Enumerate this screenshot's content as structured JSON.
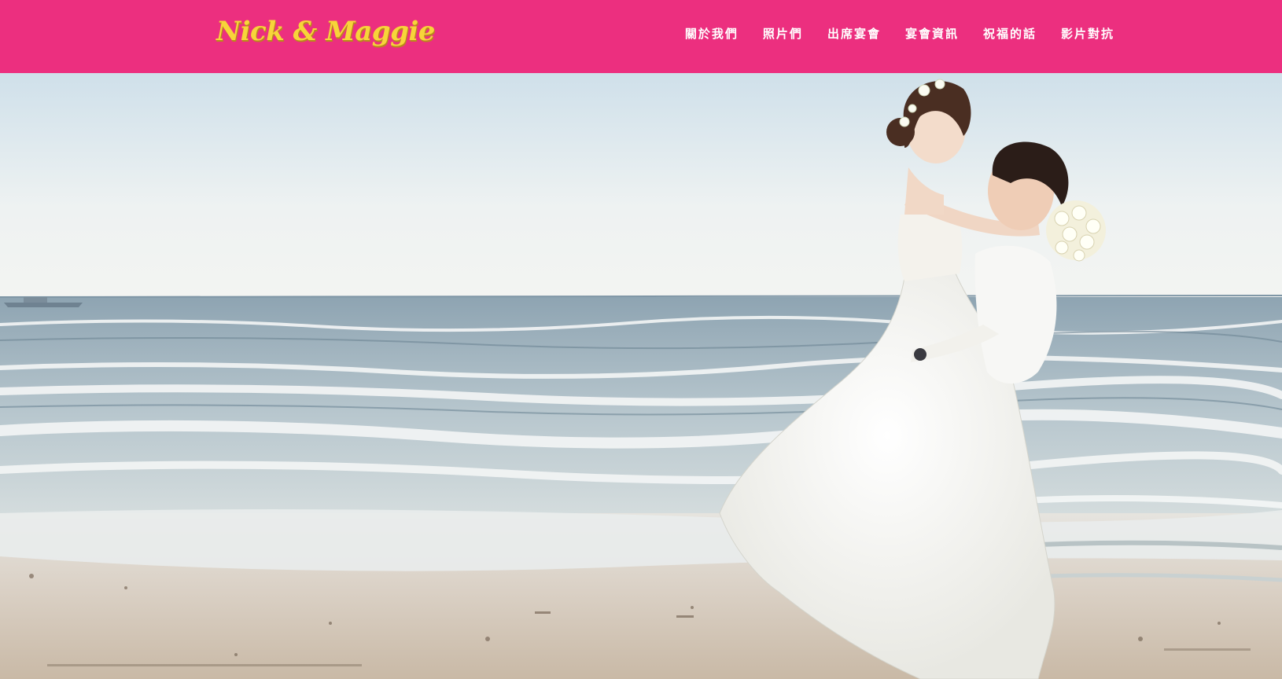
{
  "brand": {
    "title": "Nick & Maggie",
    "color": "#f7d43a"
  },
  "navbar": {
    "background": "#ec2f7f",
    "items": [
      {
        "label": "關於我們"
      },
      {
        "label": "照片們"
      },
      {
        "label": "出席宴會"
      },
      {
        "label": "宴會資訊"
      },
      {
        "label": "祝福的話"
      },
      {
        "label": "影片對抗"
      }
    ]
  },
  "hero": {
    "image": "wedding-beach-photo",
    "description_icon": "couple-on-beach-image"
  }
}
